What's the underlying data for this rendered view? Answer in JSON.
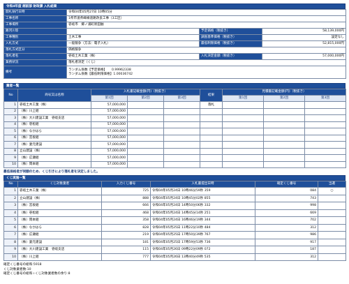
{
  "title": "令和4年度 越前部 財政課 入札結果",
  "info": {
    "rows": [
      {
        "label": "開札執行日時",
        "value": "令和04年05月27日 10時05分"
      },
      {
        "label": "工事名称",
        "value": "1県市道県峰線道路改良工事（3工区）"
      },
      {
        "label": "工事場所",
        "value": "壱岐市　郷ノ浦町新田触"
      },
      {
        "label": "路河川等",
        "value": "",
        "label2": "予定価格（税抜き）",
        "value2": "58,139,000円"
      },
      {
        "label": "工事種別",
        "value": "土木工事",
        "label2": "調査基準価格（税抜き）",
        "value2": "設定なし"
      },
      {
        "label": "入札方式",
        "value": "一般競争（方法：電子入札）",
        "label2": "最低制限価格（税抜き）",
        "value2": "52,815,000円"
      },
      {
        "label": "落札方式区分",
        "value": "価格競争"
      },
      {
        "label": "落札者名",
        "value": "壱岐土木工業（株）",
        "label2": "入札決定金額（税抜き）",
        "value2": "57,000,000円"
      },
      {
        "label": "業務状況",
        "value": "落札者決定（くじ）"
      },
      {
        "label": "備考",
        "lines": [
          "ランダム係数【予定価格】　　0.99962338",
          "ランダム係数【最低制限価格】1.00036742"
        ]
      }
    ]
  },
  "bidders": {
    "section_title": "業者一覧",
    "headers": {
      "no": "No",
      "name": "商号又は名称",
      "group1": "入札書記載金額(円)（税抜き）",
      "group2": "見積書記載金額(円)（税抜き）",
      "round1": "第1回",
      "round2": "第2回",
      "round3": "第3回",
      "result": "結果"
    },
    "rows": [
      {
        "no": "1",
        "name": "壱岐土木工業（株）",
        "amount": "57,000,000",
        "result": "落札"
      },
      {
        "no": "2",
        "name": "（株）川上組",
        "amount": "57,000,000",
        "result": ""
      },
      {
        "no": "3",
        "name": "（株）大川建設工業　壱岐支店",
        "amount": "57,000,000",
        "result": ""
      },
      {
        "no": "4",
        "name": "（株）壱松組",
        "amount": "57,000,000",
        "result": ""
      },
      {
        "no": "5",
        "name": "（株）なかはら",
        "amount": "57,000,000",
        "result": ""
      },
      {
        "no": "6",
        "name": "（株）宮坂組",
        "amount": "57,000,000",
        "result": ""
      },
      {
        "no": "7",
        "name": "（株）妻元建設",
        "amount": "57,000,000",
        "result": ""
      },
      {
        "no": "8",
        "name": "立山建設（株）",
        "amount": "57,000,000",
        "result": ""
      },
      {
        "no": "9",
        "name": "（株）広瀬組",
        "amount": "57,000,000",
        "result": ""
      },
      {
        "no": "10",
        "name": "（株）岡本組",
        "amount": "57,000,000",
        "result": ""
      }
    ]
  },
  "note": "最低価格者が同額のため、くじ引きにより落札者を決定しました。",
  "lottery": {
    "section_title": "くじ実施一覧",
    "headers": {
      "no": "No",
      "name": "くじ対象業者",
      "entered": "入力くじ番号",
      "datetime": "入札書提出日時",
      "confirmed": "確定くじ番号",
      "win": "当選"
    },
    "rows": [
      {
        "no": "1",
        "name": "壱岐土木工業（株）",
        "entered": "725",
        "datetime": "令和04年05月24日 10時46分59秒 359",
        "confirmed": "084",
        "win": "○"
      },
      {
        "no": "2",
        "name": "立山建設（株）",
        "entered": "888",
        "datetime": "令和04年05月24日 10時45分02秒 855",
        "confirmed": "743",
        "win": ""
      },
      {
        "no": "3",
        "name": "（株）宮坂組",
        "entered": "666",
        "datetime": "令和04年05月24日 14時50分06秒 332",
        "confirmed": "998",
        "win": ""
      },
      {
        "no": "4",
        "name": "（株）壱松組",
        "entered": "468",
        "datetime": "令和04年05月24日 14時45分14秒 251",
        "confirmed": "669",
        "win": ""
      },
      {
        "no": "5",
        "name": "（株）岡本組",
        "entered": "358",
        "datetime": "令和04年05月24日 16時46分19秒 344",
        "confirmed": "702",
        "win": ""
      },
      {
        "no": "6",
        "name": "（株）なかはら",
        "entered": "828",
        "datetime": "令和04年05月25日 11時22分10秒 484",
        "confirmed": "312",
        "win": ""
      },
      {
        "no": "7",
        "name": "（株）広瀬組",
        "entered": "219",
        "datetime": "令和04年05月25日 17時50分39秒 767",
        "confirmed": "986",
        "win": ""
      },
      {
        "no": "8",
        "name": "（株）妻元建設",
        "entered": "181",
        "datetime": "令和04年05月25日 17時59分53秒 736",
        "confirmed": "917",
        "win": ""
      },
      {
        "no": "9",
        "name": "（株）大川建設工業　壱岐支店",
        "entered": "115",
        "datetime": "令和04年05月26日 09時22分09秒 072",
        "confirmed": "187",
        "win": ""
      },
      {
        "no": "10",
        "name": "（株）川上組",
        "entered": "777",
        "datetime": "令和04年05月26日 13時40分49秒 535",
        "confirmed": "312",
        "win": ""
      }
    ]
  },
  "footer": {
    "line1": "確定くじ番号の総和:5918",
    "line2": "くじ対象業者数:10",
    "line3": "確定くじ番号の総和÷くじ対象業者数の余り:8"
  }
}
